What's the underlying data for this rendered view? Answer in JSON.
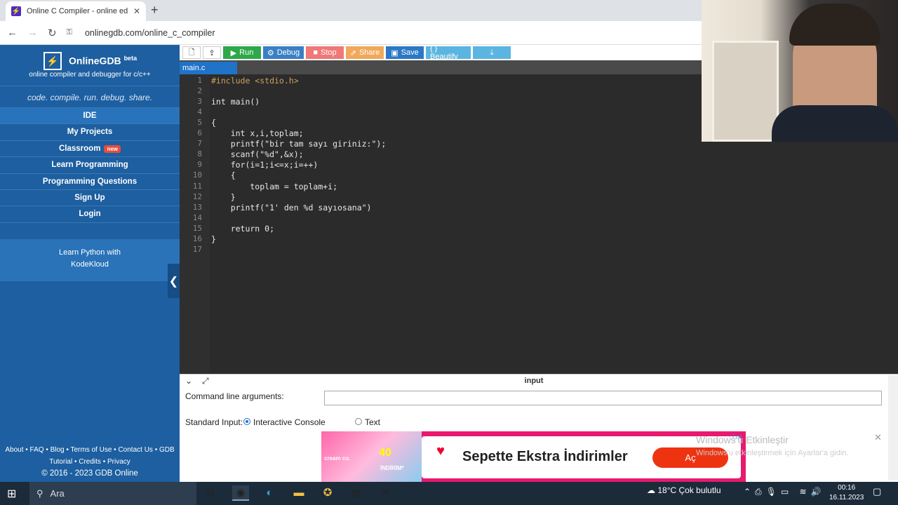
{
  "browser": {
    "tab_title": "Online C Compiler - online edito",
    "tab_close": "✕",
    "new_tab": "+",
    "url": "onlinegdb.com/online_c_compiler"
  },
  "sidebar": {
    "brand": "OnlineGDB",
    "brand_sup": "beta",
    "tagline": "online compiler and debugger for c/c++",
    "motto": "code. compile. run. debug. share.",
    "items": [
      {
        "label": "IDE"
      },
      {
        "label": "My Projects"
      },
      {
        "label": "Classroom",
        "badge": "new"
      },
      {
        "label": "Learn Programming"
      },
      {
        "label": "Programming Questions"
      },
      {
        "label": "Sign Up"
      },
      {
        "label": "Login"
      }
    ],
    "promo_line1": "Learn Python with",
    "promo_line2": "KodeKloud",
    "footer_line1": "About • FAQ • Blog • Terms of Use • Contact Us • GDB",
    "footer_line2": "Tutorial • Credits • Privacy",
    "copyright": "© 2016 - 2023 GDB Online"
  },
  "toolbar": {
    "run": "Run",
    "debug": "Debug",
    "stop": "Stop",
    "share": "Share",
    "save": "Save",
    "beautify": "{ } Beautify",
    "colors": {
      "run": "#2ea84a",
      "debug": "#3a80c4",
      "stop": "#f07878",
      "share": "#f0a85a",
      "save": "#2b78c5",
      "beautify": "#5bb5e0",
      "download": "#5bb5e0"
    }
  },
  "editor": {
    "filename": "main.c",
    "line_numbers": [
      "1",
      "2",
      "3",
      "4",
      "5",
      "6",
      "7",
      "8",
      "9",
      "10",
      "11",
      "12",
      "13",
      "14",
      "15",
      "16",
      "17"
    ],
    "lines": [
      "#include <stdio.h>",
      "",
      "int main()",
      "",
      "{",
      "    int x,i,toplam;",
      "    printf(\"bir tam sayı giriniz:\");",
      "    scanf(\"%d\",&x);",
      "    for(i=1;i<=x;i=++)",
      "    {",
      "        toplam = toplam+i;",
      "    }",
      "    printf(\"1' den %d sayıosana\")",
      "",
      "    return 0;",
      "}",
      ""
    ]
  },
  "input_panel": {
    "title": "input",
    "cmd_label": "Command line arguments:",
    "cmd_value": "",
    "stdin_label": "Standard Input:",
    "opt_interactive": "Interactive Console",
    "opt_text": "Text",
    "selected": "Interactive Console"
  },
  "ad": {
    "text": "Sepette Ekstra İndirimler",
    "button": "Aç",
    "img_line1": "cream co.",
    "img_line2": "İNDİRİM*",
    "img_pct": "40"
  },
  "watermark": {
    "line1": "Windows'u Etkinleştir",
    "line2": "Windows'u etkinleştirmek için Ayarlar'a gidin."
  },
  "taskbar": {
    "search": "Ara",
    "weather": "18°C  Çok bulutlu",
    "time": "00:16",
    "date": "16.11.2023"
  }
}
